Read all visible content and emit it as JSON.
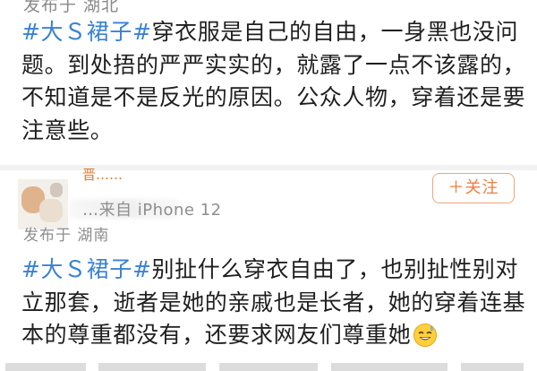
{
  "post1": {
    "location_cut": "发布于 湖北",
    "hashtag": "#大Ｓ裙子#",
    "text": "穿衣服是自己的自由，一身黑也没问题。到处捂的严严实实的，就露了一点不该露的，不知道是不是反光的原因。公众人物，穿着还是要注意些。"
  },
  "post2": {
    "username_cut": "晋……",
    "meta_cut": "…来自 iPhone 12",
    "from": "发布于 湖南",
    "follow_label": "＋关注",
    "hashtag": "#大Ｓ裙子#",
    "text": "别扯什么穿衣自由了，也别扯性别对立那套，逝者是她的亲戚也是长者，她的穿着连基本的尊重都没有，还要求网友们尊重她",
    "emoji": "sweat-smile-emoji"
  },
  "colors": {
    "hashtag": "#3a82d6",
    "follow": "#ef7d3c",
    "meta": "#8e8e8e"
  }
}
